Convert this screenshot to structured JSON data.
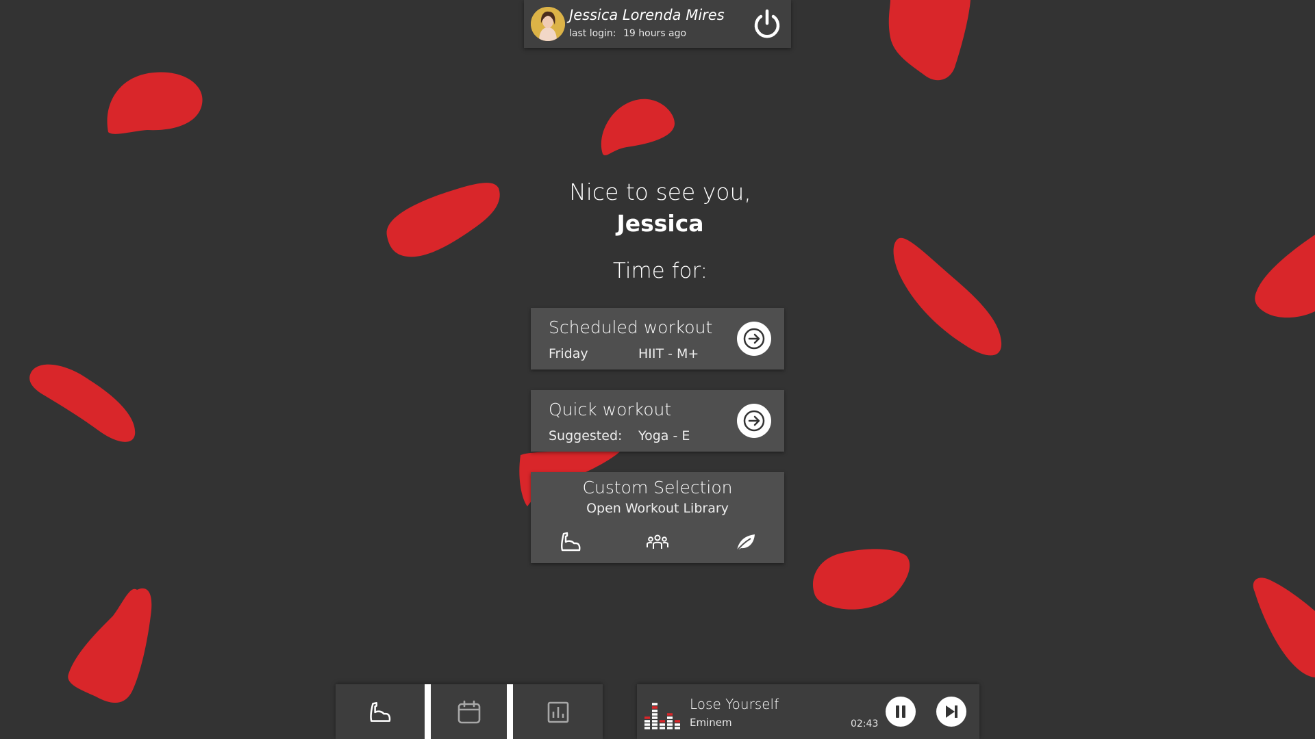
{
  "user": {
    "name": "Jessica Lorenda Mires",
    "last_login_label": "last login:",
    "last_login_value": "19 hours ago"
  },
  "greeting": {
    "line1": "Nice to see you,",
    "name": "Jessica",
    "time_for": "Time for:"
  },
  "cards": {
    "scheduled": {
      "title": "Scheduled workout",
      "day": "Friday",
      "workout": "HIIT - M+"
    },
    "quick": {
      "title": "Quick workout",
      "label": "Suggested:",
      "workout": "Yoga - E"
    },
    "custom": {
      "title": "Custom Selection",
      "subtitle": "Open Workout Library"
    }
  },
  "library_icons": [
    "muscle-icon",
    "group-icon",
    "leaf-icon"
  ],
  "nav": {
    "items": [
      "muscle-icon",
      "calendar-icon",
      "chart-icon"
    ],
    "active": 0
  },
  "player": {
    "title": "Lose Yourself",
    "artist": "Eminem",
    "time": "02:43"
  },
  "colors": {
    "background": "#333333",
    "accent": "#d9262a",
    "card": "#4f4f4f",
    "panel": "#3d3d3d"
  }
}
